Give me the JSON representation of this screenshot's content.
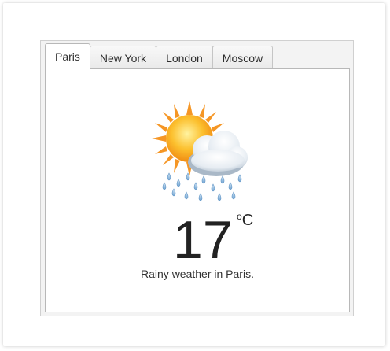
{
  "tabs": [
    {
      "label": "Paris",
      "active": true
    },
    {
      "label": "New York",
      "active": false
    },
    {
      "label": "London",
      "active": false
    },
    {
      "label": "Moscow",
      "active": false
    }
  ],
  "weather": {
    "icon": "sun-cloud-rain-icon",
    "temperature": "17",
    "unit_degree": "o",
    "unit_letter": "C",
    "description": "Rainy weather in Paris."
  },
  "colors": {
    "sun": "#f7a21c",
    "cloud": "#e8edf2",
    "rain": "#7fb0dc"
  }
}
